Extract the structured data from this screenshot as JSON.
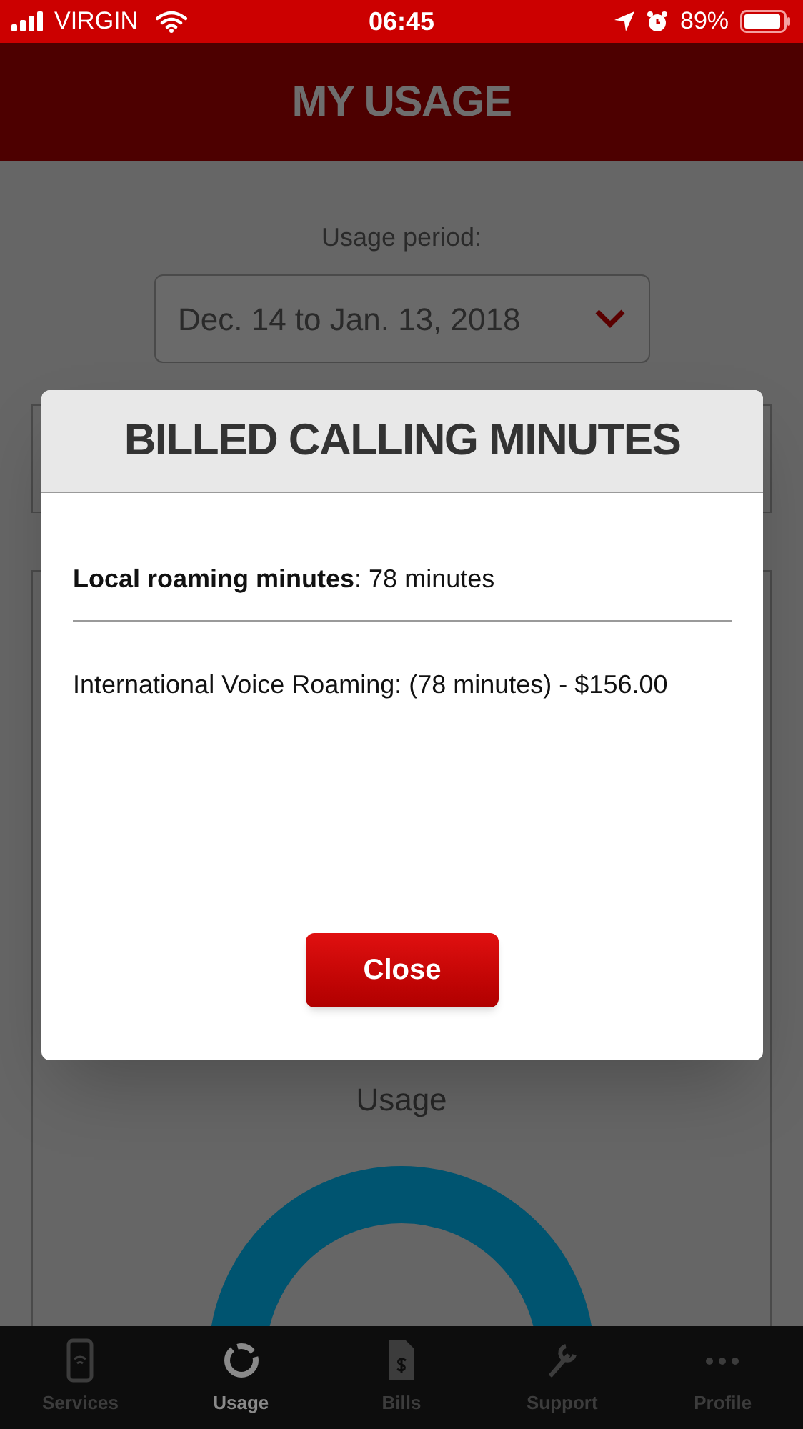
{
  "status_bar": {
    "carrier": "VIRGIN",
    "time": "06:45",
    "battery": "89%"
  },
  "header": {
    "title": "MY USAGE"
  },
  "usage_period": {
    "label": "Usage period:",
    "value": "Dec. 14 to Jan. 13, 2018"
  },
  "usage_card": {
    "title": "Usage"
  },
  "dialog": {
    "title": "BILLED CALLING MINUTES",
    "lines": [
      {
        "text": "**Local roaming minutes**: 78 minutes"
      },
      {
        "text": "International Voice Roaming: (78 minutes) - $156.00"
      }
    ],
    "button": "Close"
  },
  "tab_bar": [
    {
      "label": "Services",
      "selected": false
    },
    {
      "label": "Usage",
      "selected": true
    },
    {
      "label": "Bills",
      "selected": false
    },
    {
      "label": "Support",
      "selected": false
    },
    {
      "label": "Profile",
      "selected": false
    }
  ]
}
